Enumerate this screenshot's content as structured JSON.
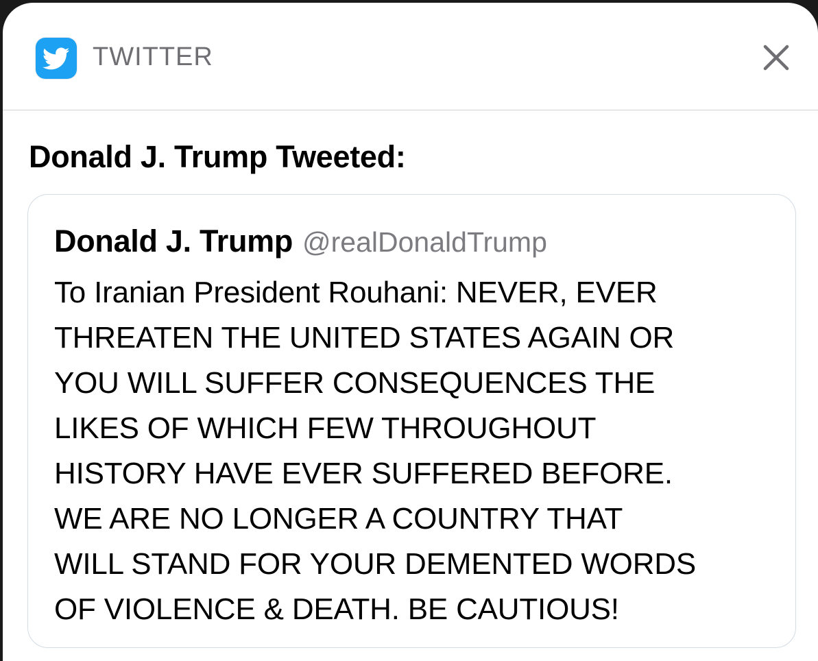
{
  "header": {
    "app_name": "TWITTER",
    "app_icon": "twitter-bird-icon",
    "close_icon": "close-icon",
    "accent_color": "#1da1f2"
  },
  "notification": {
    "title": "Donald J. Trump Tweeted:"
  },
  "tweet": {
    "author_name": "Donald J. Trump",
    "author_handle": "@realDonaldTrump",
    "lines": [
      "To Iranian President Rouhani: NEVER, EVER",
      "THREATEN THE UNITED STATES AGAIN OR",
      "YOU WILL SUFFER CONSEQUENCES THE",
      "LIKES OF WHICH FEW THROUGHOUT",
      "HISTORY HAVE EVER SUFFERED BEFORE.",
      "WE ARE NO LONGER A COUNTRY THAT",
      "WILL STAND FOR YOUR DEMENTED WORDS",
      "OF VIOLENCE & DEATH. BE CAUTIOUS!"
    ]
  }
}
